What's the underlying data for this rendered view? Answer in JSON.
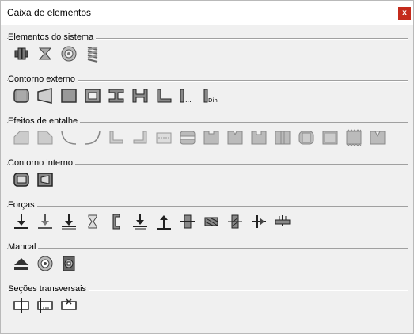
{
  "window": {
    "title": "Caixa de elementos",
    "close_glyph": "x"
  },
  "sections": [
    {
      "label": "Elementos do sistema",
      "icons": [
        "shaft-coupling-icon",
        "bearing-hourglass-icon",
        "ring-element-icon",
        "spring-stack-icon"
      ]
    },
    {
      "label": "Contorno externo",
      "icons": [
        "cylinder-icon",
        "cone-icon",
        "rectangle-solid-icon",
        "hollow-rectangle-icon",
        "i-profile-icon",
        "h-profile-icon",
        "l-profile-icon",
        "l-dots-icon",
        "l-din-icon"
      ]
    },
    {
      "label": "Efeitos de entalhe",
      "icons": [
        "chamfer-left-icon",
        "chamfer-right-icon",
        "radius-left-icon",
        "radius-right-icon",
        "undercut-left-icon",
        "undercut-right-icon",
        "cross-hole-icon",
        "groove-icon",
        "recess-icon",
        "v-notch-icon",
        "square-groove-icon",
        "keyway-icon",
        "spline-icon",
        "polygon-icon",
        "knurl-icon",
        "thread-icon"
      ]
    },
    {
      "label": "Contorno interno",
      "icons": [
        "inner-cylinder-icon",
        "inner-cone-icon"
      ]
    },
    {
      "label": "Forças",
      "icons": [
        "force-down-icon",
        "force-down-offset-icon",
        "force-line-icon",
        "hourglass-load-icon",
        "bracket-load-icon",
        "distributed-force-icon",
        "force-up-icon",
        "moment-icon",
        "torque-icon",
        "bending-icon",
        "axial-force-icon",
        "support-icon"
      ]
    },
    {
      "label": "Mancal",
      "icons": [
        "eject-bearing-icon",
        "roller-bearing-icon",
        "fixed-bearing-icon"
      ]
    },
    {
      "label": "Seções transversais",
      "icons": [
        "section-plain-icon",
        "section-dots-icon",
        "section-cross-icon"
      ]
    }
  ],
  "icon_texts": {
    "l_dots": "...",
    "l_din": "Din"
  }
}
